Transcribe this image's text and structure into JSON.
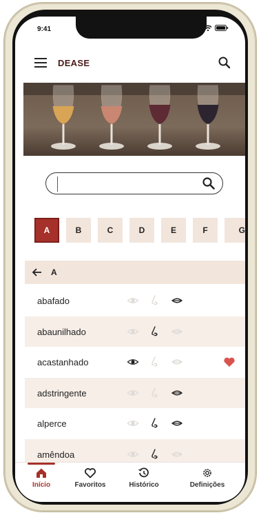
{
  "status": {
    "time": "9:41"
  },
  "app": {
    "title": "DEASE"
  },
  "search": {
    "value": "",
    "placeholder": ""
  },
  "letters": [
    "A",
    "B",
    "C",
    "D",
    "E",
    "F",
    "G"
  ],
  "active_letter": "A",
  "section": {
    "label": "A"
  },
  "terms": [
    {
      "label": "abafado",
      "eye": false,
      "nose": false,
      "mouth": true,
      "favorite": false
    },
    {
      "label": "abaunilhado",
      "eye": false,
      "nose": true,
      "mouth": false,
      "favorite": false
    },
    {
      "label": "acastanhado",
      "eye": true,
      "nose": false,
      "mouth": false,
      "favorite": true
    },
    {
      "label": "adstringente",
      "eye": false,
      "nose": false,
      "mouth": true,
      "favorite": false
    },
    {
      "label": "alperce",
      "eye": false,
      "nose": true,
      "mouth": true,
      "favorite": false
    },
    {
      "label": "amêndoa",
      "eye": false,
      "nose": true,
      "mouth": false,
      "favorite": false
    }
  ],
  "nav": {
    "inicio": "Início",
    "favoritos": "Favoritos",
    "historico": "Histórico",
    "definicoes": "Definições"
  },
  "colors": {
    "accent": "#a6302a",
    "chip_bg": "#f2e5dc",
    "row_alt": "#f7eee8",
    "heart": "#d9534f"
  }
}
